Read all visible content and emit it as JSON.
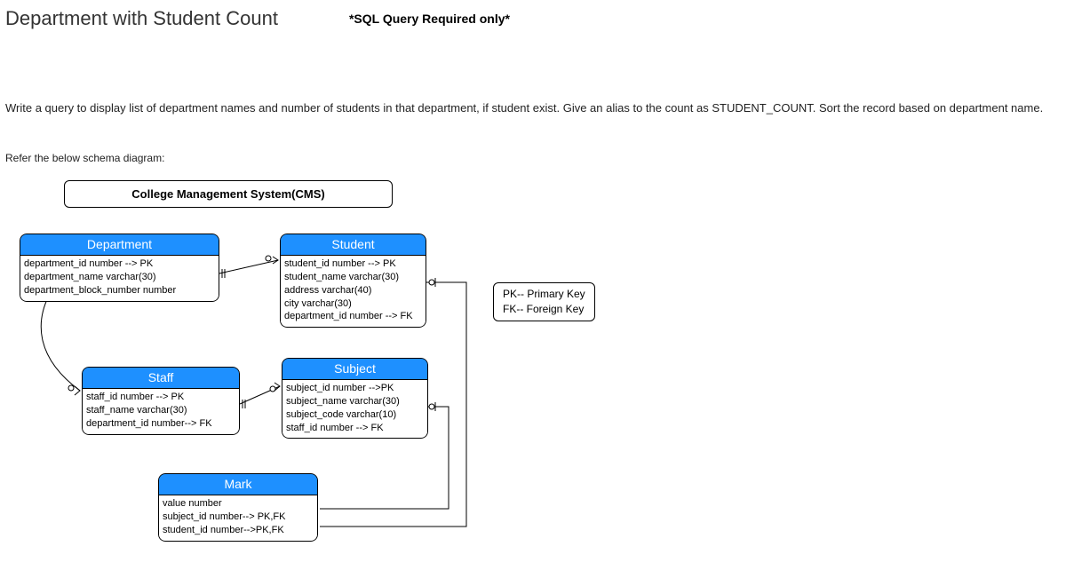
{
  "heading": {
    "title": "Department with Student Count",
    "subtitle": "*SQL Query Required only*"
  },
  "question_text": "Write a query to display list of department names  and number of students in that department, if student exist. Give an alias to the count as STUDENT_COUNT. Sort the record based on department name.",
  "refer_text": "Refer the below schema diagram:",
  "diagram": {
    "system_title": "College Management System(CMS)",
    "legend": {
      "pk": "PK--  Primary Key",
      "fk": "FK-- Foreign Key"
    },
    "entities": {
      "department": {
        "name": "Department",
        "cols": [
          "department_id number --> PK",
          "department_name varchar(30)",
          "department_block_number number"
        ]
      },
      "student": {
        "name": "Student",
        "cols": [
          "student_id number --> PK",
          "student_name varchar(30)",
          "address varchar(40)",
          "city varchar(30)",
          "department_id number --> FK"
        ]
      },
      "staff": {
        "name": "Staff",
        "cols": [
          "staff_id number --> PK",
          "staff_name varchar(30)",
          "department_id number--> FK"
        ]
      },
      "subject": {
        "name": "Subject",
        "cols": [
          "subject_id number -->PK",
          "subject_name varchar(30)",
          "subject_code varchar(10)",
          "staff_id number --> FK"
        ]
      },
      "mark": {
        "name": "Mark",
        "cols": [
          "value number",
          "subject_id number--> PK,FK",
          "student_id number-->PK,FK"
        ]
      }
    }
  }
}
